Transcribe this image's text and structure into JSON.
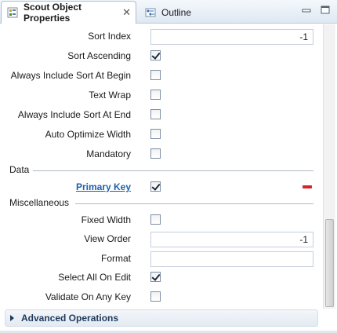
{
  "tabs": {
    "active_label": "Scout Object Properties",
    "inactive_label": "Outline"
  },
  "icons": {
    "scout_properties": "properties-icon",
    "outline": "outline-icon",
    "close": "close-icon",
    "minimize": "minimize-icon",
    "maximize": "maximize-icon",
    "remove": "minus-icon",
    "expand": "chevron-right-icon"
  },
  "rows": {
    "sort_index": {
      "label": "Sort Index",
      "value": "-1"
    },
    "sort_ascending": {
      "label": "Sort Ascending",
      "checked": true
    },
    "always_include_sort_at_begin": {
      "label": "Always Include Sort At Begin",
      "checked": false
    },
    "text_wrap": {
      "label": "Text Wrap",
      "checked": false
    },
    "always_include_sort_at_end": {
      "label": "Always Include Sort At End",
      "checked": false
    },
    "auto_optimize_width": {
      "label": "Auto Optimize Width",
      "checked": false
    },
    "mandatory": {
      "label": "Mandatory",
      "checked": false
    }
  },
  "data_section": {
    "title": "Data",
    "primary_key": {
      "label": "Primary Key",
      "checked": true
    }
  },
  "misc_section": {
    "title": "Miscellaneous",
    "fixed_width": {
      "label": "Fixed Width",
      "checked": false
    },
    "view_order": {
      "label": "View Order",
      "value": "-1"
    },
    "format": {
      "label": "Format",
      "value": ""
    },
    "select_all_on_edit": {
      "label": "Select All On Edit",
      "checked": true
    },
    "validate_on_any_key": {
      "label": "Validate On Any Key",
      "checked": false
    }
  },
  "advanced_operations": {
    "label": "Advanced Operations"
  },
  "colors": {
    "link": "#1d5fa8",
    "remove": "#d8232a",
    "tab_background": "#dfe8f2"
  }
}
